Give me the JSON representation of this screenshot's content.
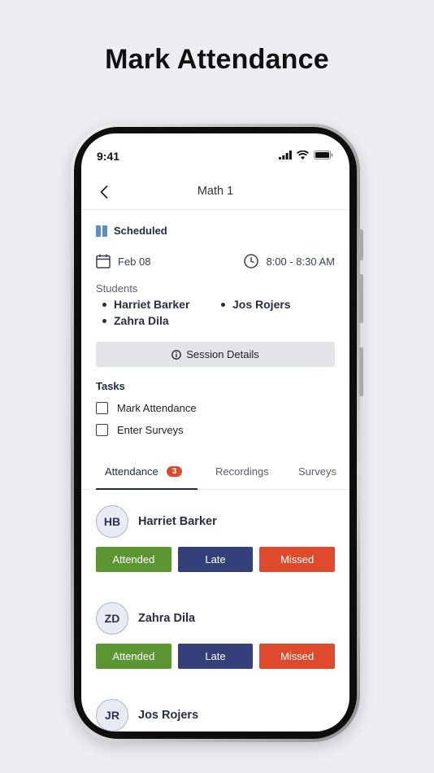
{
  "headline": "Mark Attendance",
  "status_bar": {
    "time": "9:41"
  },
  "nav": {
    "title": "Math 1"
  },
  "session": {
    "status": "Scheduled",
    "date": "Feb 08",
    "time_range": "8:00 - 8:30 AM",
    "students_label": "Students",
    "students": [
      "Harriet Barker",
      "Jos Rojers",
      "Zahra Dila"
    ],
    "details_button": "Session Details"
  },
  "tasks": {
    "label": "Tasks",
    "items": [
      "Mark Attendance",
      "Enter Surveys"
    ]
  },
  "tabs": [
    {
      "label": "Attendance",
      "badge": "3"
    },
    {
      "label": "Recordings"
    },
    {
      "label": "Surveys"
    }
  ],
  "attendance": [
    {
      "initials": "HB",
      "name": "Harriet Barker"
    },
    {
      "initials": "ZD",
      "name": "Zahra Dila"
    },
    {
      "initials": "JR",
      "name": "Jos Rojers"
    }
  ],
  "actions": {
    "attended": "Attended",
    "late": "Late",
    "missed": "Missed"
  },
  "colors": {
    "attended": "#5b9632",
    "late": "#34407a",
    "missed": "#e04a2c",
    "scheduled_icon": "#5b8fc4",
    "badge": "#e04a2c"
  },
  "icons": {
    "back": "chevron-left-icon",
    "status": "book-icon",
    "date": "calendar-icon",
    "time": "clock-icon",
    "details": "info-icon"
  }
}
